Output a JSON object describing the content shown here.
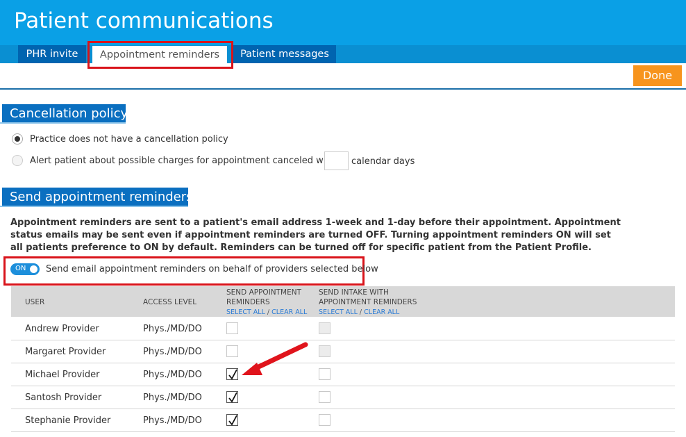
{
  "header": {
    "title": "Patient communications"
  },
  "tabs": [
    {
      "label": "PHR invite"
    },
    {
      "label": "Appointment reminders"
    },
    {
      "label": "Patient messages"
    }
  ],
  "done_label": "Done",
  "cancellation": {
    "heading": "Cancellation policy",
    "option_none": "Practice does not have a cancellation policy",
    "option_alert": "Alert patient about possible charges for appointment canceled within",
    "days_value": "",
    "days_suffix": "calendar days"
  },
  "reminders": {
    "heading": "Send appointment reminders",
    "description": "Appointment reminders are sent to a patient's email address 1-week and 1-day before their appointment. Appointment status emails may be sent even if appointment reminders are turned OFF. Turning appointment reminders ON will set all patients preference to ON by default. Reminders can be turned off for specific patient from the Patient Profile.",
    "toggle_label": "ON",
    "toggle_text": "Send email appointment reminders on behalf of providers selected below"
  },
  "table": {
    "col_user": "USER",
    "col_access": "ACCESS LEVEL",
    "col_send_line1": "SEND APPOINTMENT",
    "col_send_line2": "REMINDERS",
    "col_intake_line1": "SEND INTAKE WITH",
    "col_intake_line2": "APPOINTMENT REMINDERS",
    "select_all": "SELECT ALL",
    "clear_all": "CLEAR ALL",
    "sep": "/",
    "rows": [
      {
        "user": "Andrew Provider",
        "access": "Phys./MD/DO"
      },
      {
        "user": "Margaret Provider",
        "access": "Phys./MD/DO"
      },
      {
        "user": "Michael Provider",
        "access": "Phys./MD/DO"
      },
      {
        "user": "Santosh Provider",
        "access": "Phys./MD/DO"
      },
      {
        "user": "Stephanie Provider",
        "access": "Phys./MD/DO"
      }
    ]
  }
}
